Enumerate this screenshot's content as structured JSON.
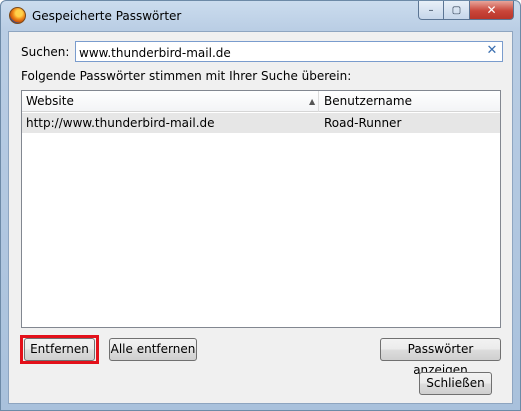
{
  "window": {
    "title": "Gespeicherte Passwörter",
    "icon": "firefox-icon",
    "caption_buttons": {
      "minimize": "–",
      "maximize": "▢",
      "close": "✕"
    }
  },
  "search": {
    "label": "Suchen:",
    "value": "www.thunderbird-mail.de",
    "clear_symbol": "✕"
  },
  "match_text": "Folgende Passwörter stimmen mit Ihrer Suche überein:",
  "list": {
    "columns": [
      "Website",
      "Benutzername"
    ],
    "sort_indicator": "▲",
    "rows": [
      {
        "website": "http://www.thunderbird-mail.de",
        "username": "Road-Runner"
      }
    ]
  },
  "buttons": {
    "remove": "Entfernen",
    "remove_all": "Alle entfernen",
    "show_passwords": "Passwörter anzeigen",
    "close": "Schließen"
  },
  "colors": {
    "highlight": "#e3101a",
    "selected_row": "#e6e6e6"
  }
}
